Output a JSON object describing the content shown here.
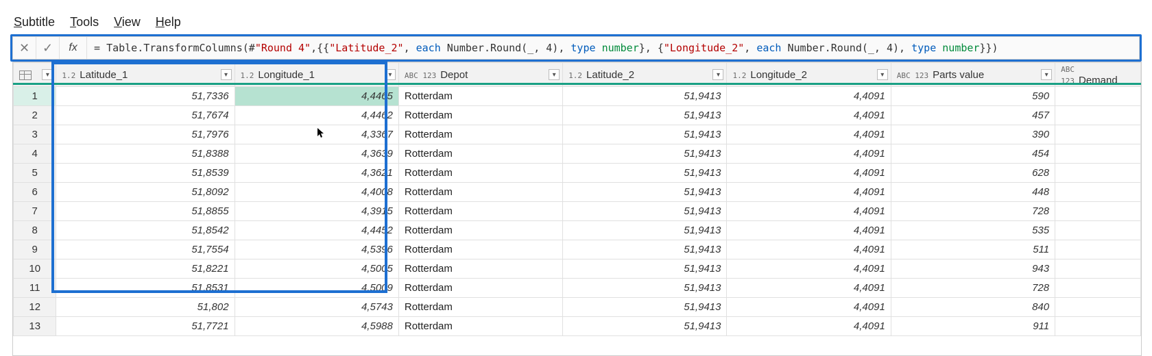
{
  "menus": {
    "subtitle": "Subtitle",
    "tools": "Tools",
    "view": "View",
    "help": "Help"
  },
  "formula_bar": {
    "cancel_glyph": "✕",
    "accept_glyph": "✓",
    "fx_label": "fx",
    "eq": "= ",
    "p1": "Table.TransformColumns(#",
    "s1": "\"Round 4\"",
    "p2": ",{{",
    "s2": "\"Latitude_2\"",
    "p3": ", ",
    "b1": "each",
    "p4": " Number.Round(_, 4), ",
    "b2": "type",
    "p5": " ",
    "t1": "number",
    "p6": "}, {",
    "s3": "\"Longitude_2\"",
    "p7": ", ",
    "b3": "each",
    "p8": " Number.Round(_, 4), ",
    "b4": "type",
    "p9": " ",
    "t2": "number",
    "p10": "}})"
  },
  "columns": {
    "c1": {
      "type": "1.2",
      "label": "Latitude_1"
    },
    "c2": {
      "type": "1.2",
      "label": "Longitude_1"
    },
    "c3": {
      "type": "ABC\n123",
      "label": "Depot"
    },
    "c4": {
      "type": "1.2",
      "label": "Latitude_2"
    },
    "c5": {
      "type": "1.2",
      "label": "Longitude_2"
    },
    "c6": {
      "type": "ABC\n123",
      "label": "Parts value"
    },
    "c7": {
      "type": "ABC\n123",
      "label": "Demand"
    }
  },
  "rows": [
    {
      "n": "1",
      "lat1": "51,7336",
      "lon1": "4,4465",
      "depot": "Rotterdam",
      "lat2": "51,9413",
      "lon2": "4,4091",
      "pv": "590",
      "dem": ""
    },
    {
      "n": "2",
      "lat1": "51,7674",
      "lon1": "4,4462",
      "depot": "Rotterdam",
      "lat2": "51,9413",
      "lon2": "4,4091",
      "pv": "457",
      "dem": ""
    },
    {
      "n": "3",
      "lat1": "51,7976",
      "lon1": "4,3367",
      "depot": "Rotterdam",
      "lat2": "51,9413",
      "lon2": "4,4091",
      "pv": "390",
      "dem": ""
    },
    {
      "n": "4",
      "lat1": "51,8388",
      "lon1": "4,3639",
      "depot": "Rotterdam",
      "lat2": "51,9413",
      "lon2": "4,4091",
      "pv": "454",
      "dem": ""
    },
    {
      "n": "5",
      "lat1": "51,8539",
      "lon1": "4,3621",
      "depot": "Rotterdam",
      "lat2": "51,9413",
      "lon2": "4,4091",
      "pv": "628",
      "dem": ""
    },
    {
      "n": "6",
      "lat1": "51,8092",
      "lon1": "4,4008",
      "depot": "Rotterdam",
      "lat2": "51,9413",
      "lon2": "4,4091",
      "pv": "448",
      "dem": ""
    },
    {
      "n": "7",
      "lat1": "51,8855",
      "lon1": "4,3915",
      "depot": "Rotterdam",
      "lat2": "51,9413",
      "lon2": "4,4091",
      "pv": "728",
      "dem": ""
    },
    {
      "n": "8",
      "lat1": "51,8542",
      "lon1": "4,4452",
      "depot": "Rotterdam",
      "lat2": "51,9413",
      "lon2": "4,4091",
      "pv": "535",
      "dem": ""
    },
    {
      "n": "9",
      "lat1": "51,7554",
      "lon1": "4,5396",
      "depot": "Rotterdam",
      "lat2": "51,9413",
      "lon2": "4,4091",
      "pv": "511",
      "dem": ""
    },
    {
      "n": "10",
      "lat1": "51,8221",
      "lon1": "4,5005",
      "depot": "Rotterdam",
      "lat2": "51,9413",
      "lon2": "4,4091",
      "pv": "943",
      "dem": ""
    },
    {
      "n": "11",
      "lat1": "51,8531",
      "lon1": "4,5009",
      "depot": "Rotterdam",
      "lat2": "51,9413",
      "lon2": "4,4091",
      "pv": "728",
      "dem": ""
    },
    {
      "n": "12",
      "lat1": "51,802",
      "lon1": "4,5743",
      "depot": "Rotterdam",
      "lat2": "51,9413",
      "lon2": "4,4091",
      "pv": "840",
      "dem": ""
    },
    {
      "n": "13",
      "lat1": "51,7721",
      "lon1": "4,5988",
      "depot": "Rotterdam",
      "lat2": "51,9413",
      "lon2": "4,4091",
      "pv": "911",
      "dem": ""
    }
  ],
  "glyphs": {
    "dropdown": "▾"
  }
}
